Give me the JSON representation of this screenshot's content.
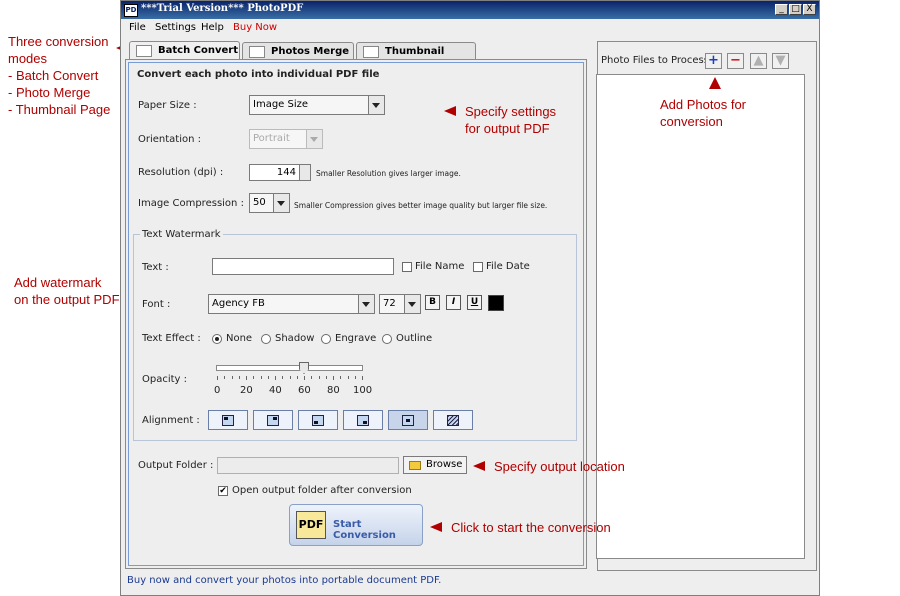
{
  "window": {
    "title": "***Trial Version*** PhotoPDF",
    "app_icon": "PD",
    "controls": [
      "_",
      "□",
      "X"
    ]
  },
  "menu": [
    "File",
    "Settings",
    "Help",
    "Buy Now"
  ],
  "tabs": [
    {
      "label": "Batch Convert",
      "active": true
    },
    {
      "label": "Photos Merge",
      "active": false
    },
    {
      "label": "Thumbnail Page",
      "active": false
    }
  ],
  "batch": {
    "heading": "Convert each photo into individual PDF file",
    "paper_size_label": "Paper Size :",
    "paper_size_value": "Image Size",
    "orientation_label": "Orientation :",
    "orientation_value": "Portrait",
    "resolution_label": "Resolution (dpi) :",
    "resolution_value": "144",
    "resolution_hint": "Smaller Resolution gives larger image.",
    "compression_label": "Image Compression :",
    "compression_value": "50",
    "compression_hint": "Smaller Compression gives better image quality but larger file size."
  },
  "watermark": {
    "group_title": "Text Watermark",
    "text_label": "Text :",
    "text_value": "",
    "file_name_label": "File Name",
    "file_date_label": "File Date",
    "font_label": "Font :",
    "font_value": "Agency FB",
    "size_value": "72",
    "bold": "B",
    "italic": "I",
    "underline": "U",
    "color": "#000000",
    "effect_label": "Text Effect :",
    "effects": [
      "None",
      "Shadow",
      "Engrave",
      "Outline"
    ],
    "effect_selected": "None",
    "opacity_label": "Opacity :",
    "opacity_value": 60,
    "opacity_ticks": [
      "0",
      "20",
      "40",
      "60",
      "80",
      "100"
    ],
    "alignment_label": "Alignment :",
    "alignment_selected_index": 4
  },
  "output": {
    "folder_label": "Output Folder :",
    "folder_value": "",
    "browse_label": "Browse",
    "open_after_label": "Open output folder after conversion",
    "open_after_checked": true,
    "start_label": "Start Conversion",
    "start_icon_text": "PDF"
  },
  "right_panel": {
    "title": "Photo Files to Process"
  },
  "status": "Buy now and convert your photos into portable document PDF.",
  "annotations": {
    "modes": [
      "Three conversion",
      "modes",
      "- Batch Convert",
      "- Photo Merge",
      "- Thumbnail Page"
    ],
    "settings": [
      "Specify settings",
      "for output PDF"
    ],
    "add_photos": [
      "Add Photos for",
      "conversion"
    ],
    "watermark": [
      "Add watermark",
      "on the output PDF"
    ],
    "output": "Specify output location",
    "start": "Click to start the conversion"
  },
  "colors": {
    "annotation": "#b00000",
    "titlebar": "#0a246a",
    "status_text": "#1a3a90"
  }
}
